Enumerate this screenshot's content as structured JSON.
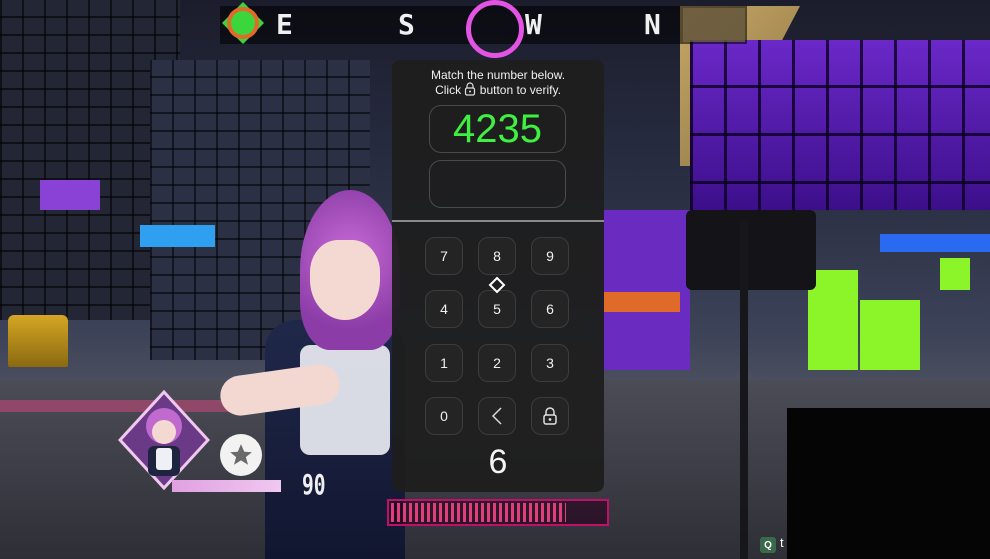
{
  "hud": {
    "compass": {
      "letters": [
        "E",
        "S",
        "W",
        "N"
      ]
    },
    "player": {
      "hp_value": "90",
      "hp_fraction": 0.72,
      "stamina_fraction": 0.82
    }
  },
  "verification": {
    "instruction_line1": "Match the number below.",
    "instruction_line2_pre": "Click",
    "instruction_line2_post": "button to verify.",
    "target_number": "4235",
    "entered_value": "",
    "keys": {
      "k7": "7",
      "k8": "8",
      "k9": "9",
      "k4": "4",
      "k5": "5",
      "k6": "6",
      "k1": "1",
      "k2": "2",
      "k3": "3",
      "k0": "0"
    },
    "big_digit": "6",
    "icons": {
      "backspace": "chevron-left-icon",
      "verify": "lock-icon"
    }
  },
  "overlay": {
    "q_badge": "Q",
    "q_text": "t"
  },
  "colors": {
    "target_number": "#40f040",
    "compass_ring": "#e454e4",
    "stamina_border": "#c0106a"
  }
}
